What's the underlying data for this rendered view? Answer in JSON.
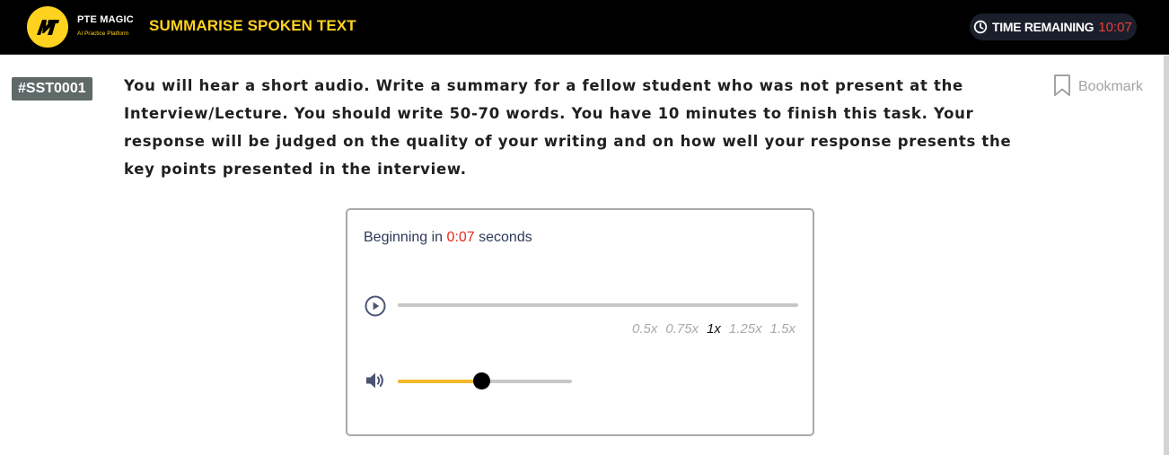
{
  "header": {
    "brand_name": "PTE MAGIC",
    "brand_tagline": "AI Practice Platform",
    "task_title": "SUMMARISE SPOKEN TEXT",
    "timer_label": "TIME REMAINING",
    "timer_value": "10:07",
    "logo_icon": "pm-monogram-icon",
    "clock_icon": "clock-icon"
  },
  "question": {
    "id": "#SST0001",
    "prompt": "You will hear a short audio. Write a summary for a fellow student who was not present at the Interview/Lecture. You should write 50-70 words. You have 10 minutes to finish this task. Your response will be judged on the quality of your writing and on how well your response presents the key points presented in the interview.",
    "bookmark_label": "Bookmark",
    "bookmark_icon": "bookmark-icon"
  },
  "player": {
    "begin_prefix": "Beginning in",
    "countdown": "0:07",
    "begin_suffix": "seconds",
    "play_icon": "play-circle-icon",
    "volume_icon": "speaker-icon",
    "progress": 0,
    "speeds": [
      "0.5x",
      "0.75x",
      "1x",
      "1.25x",
      "1.5x"
    ],
    "active_speed": "1x",
    "volume": 0.48
  },
  "colors": {
    "accent_yellow": "#ffd21f",
    "timer_red": "#e8413b",
    "countdown_red": "#e8261c",
    "volume_fill": "#f5b92a",
    "id_badge": "#5f6a68"
  }
}
